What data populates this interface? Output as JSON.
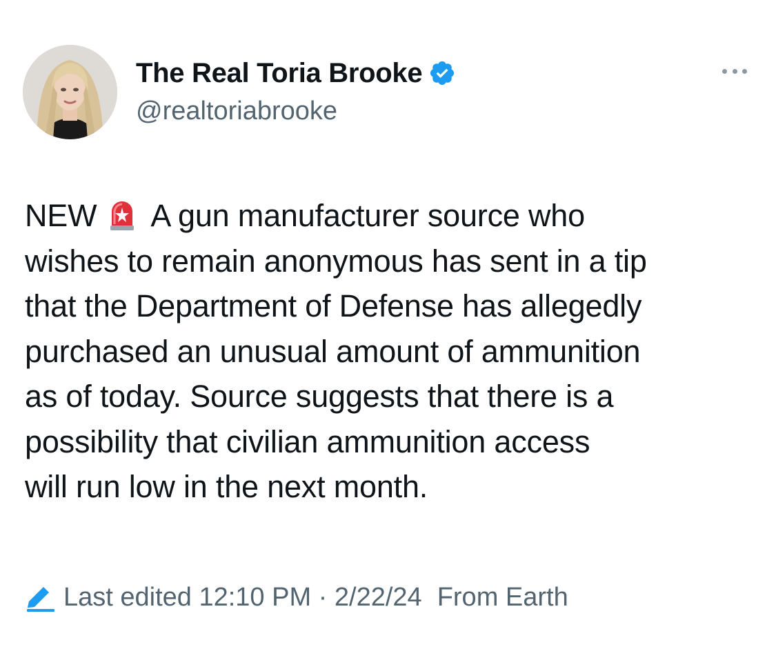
{
  "author": {
    "display_name": "The Real Toria Brooke",
    "handle": "@realtoriabrooke",
    "verified": true,
    "avatar_icon": "profile-photo"
  },
  "tweet": {
    "lines": [
      {
        "before_icon": "NEW",
        "icon": "siren-icon",
        "after_icon": "A gun manufacturer source who"
      },
      {
        "text": "wishes to remain anonymous has sent in a tip"
      },
      {
        "text": "that the Department of Defense has allegedly"
      },
      {
        "text": "purchased an unusual amount of ammunition"
      },
      {
        "text": "as of today. Source suggests that there is a"
      },
      {
        "text": "possibility that civilian ammunition access"
      },
      {
        "text": "will run low in the next month."
      }
    ]
  },
  "meta": {
    "edited_label": "Last edited 12:10 PM · 2/22/24",
    "source_label": "From Earth",
    "edit_icon": "pencil-icon"
  },
  "colors": {
    "text": "#0f1419",
    "secondary_text": "#536471",
    "verified_blue": "#1d9bf0",
    "siren_red": "#e0313a"
  }
}
